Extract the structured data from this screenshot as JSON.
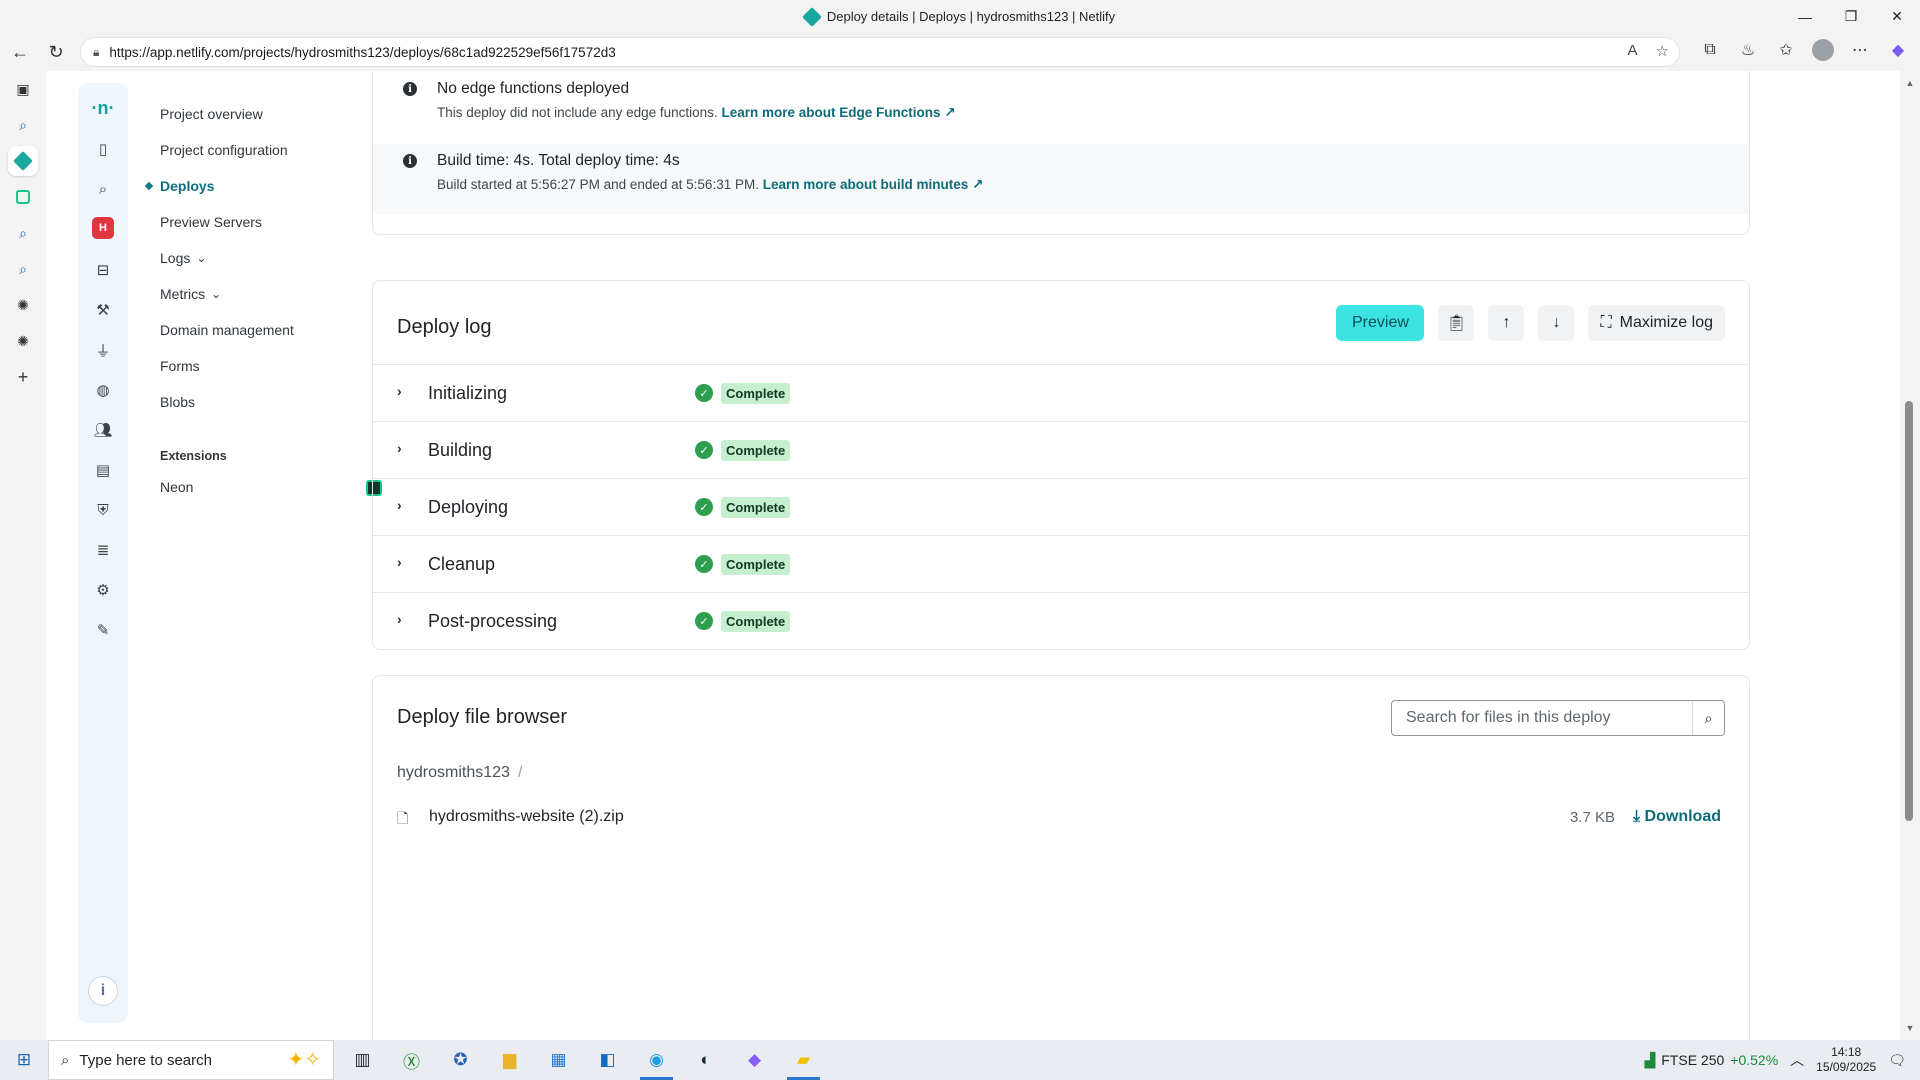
{
  "window": {
    "title": "Deploy details | Deploys | hydrosmiths123 | Netlify",
    "controls": {
      "minimize": "—",
      "restore": "❐",
      "close": "✕"
    }
  },
  "browser": {
    "url": "https://app.netlify.com/projects/hydrosmiths123/deploys/68c1ad922529ef56f17572d3",
    "nav": {
      "back": "←",
      "reload": "↻"
    }
  },
  "edge_sidebar": [
    "tabs-icon",
    "search-icon",
    "netlify-tab-icon",
    "neon-tab-icon",
    "search-icon",
    "search-icon",
    "chatgpt-icon",
    "chatgpt-icon",
    "add-icon"
  ],
  "rail": {
    "logo": "·n·",
    "team_badge": "H",
    "help": "i"
  },
  "nav": {
    "items": [
      {
        "label": "Project overview"
      },
      {
        "label": "Project configuration"
      },
      {
        "label": "Deploys",
        "active": true
      },
      {
        "label": "Preview Servers"
      },
      {
        "label": "Logs",
        "caret": "⌄"
      },
      {
        "label": "Metrics",
        "caret": "⌄"
      },
      {
        "label": "Domain management"
      },
      {
        "label": "Forms"
      },
      {
        "label": "Blobs"
      }
    ],
    "extensions_heading": "Extensions",
    "extensions": [
      {
        "label": "Neon"
      }
    ]
  },
  "info": [
    {
      "title": "No edge functions deployed",
      "text": "This deploy did not include any edge functions.",
      "link": "Learn more about Edge Functions ↗"
    },
    {
      "title": "Build time: 4s. Total deploy time: 4s",
      "text": "Build started at 5:56:27 PM and ended at 5:56:31 PM.",
      "link": "Learn more about build minutes ↗"
    }
  ],
  "deploy_log": {
    "title": "Deploy log",
    "preview_label": "Preview",
    "maximize_label": "Maximize log",
    "steps": [
      {
        "name": "Initializing",
        "status": "Complete"
      },
      {
        "name": "Building",
        "status": "Complete"
      },
      {
        "name": "Deploying",
        "status": "Complete"
      },
      {
        "name": "Cleanup",
        "status": "Complete"
      },
      {
        "name": "Post-processing",
        "status": "Complete"
      }
    ]
  },
  "file_browser": {
    "title": "Deploy file browser",
    "search_placeholder": "Search for files in this deploy",
    "breadcrumb": "hydrosmiths123",
    "breadcrumb_sep": "/",
    "files": [
      {
        "name": "hydrosmiths-website (2).zip",
        "size": "3.7 KB",
        "action": "⤓ Download"
      }
    ]
  },
  "taskbar": {
    "search_placeholder": "Type here to search",
    "ticker": "FTSE 250",
    "change": "+0.52%",
    "time": "14:18",
    "date": "15/09/2025"
  }
}
